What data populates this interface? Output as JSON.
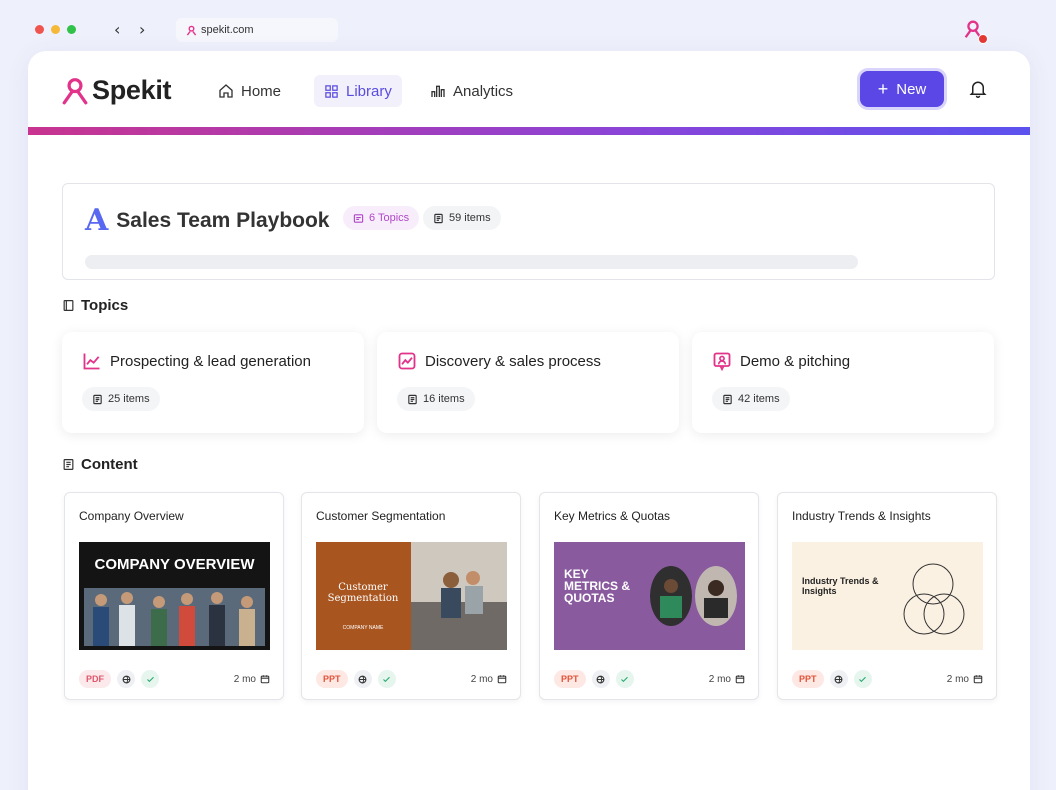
{
  "browser": {
    "url": "spekit.com",
    "back": "‹",
    "forward": "›"
  },
  "brand": {
    "name": "Spekit",
    "accent": "#5a47e6",
    "pink": "#e2338a"
  },
  "nav": {
    "home": "Home",
    "library": "Library",
    "analytics": "Analytics",
    "new_label": "New"
  },
  "playbook": {
    "title": "Sales Team Playbook",
    "topics_badge": "6 Topics",
    "items_badge": "59 items"
  },
  "topics_section": {
    "heading": "Topics",
    "cards": [
      {
        "title": "Prospecting & lead generation",
        "count": "25 items",
        "icon": "chart-line-icon"
      },
      {
        "title": "Discovery & sales process",
        "count": "16 items",
        "icon": "trend-icon"
      },
      {
        "title": "Demo & pitching",
        "count": "42 items",
        "icon": "presenter-icon"
      }
    ]
  },
  "content_section": {
    "heading": "Content",
    "cards": [
      {
        "title": "Company Overview",
        "type": "PDF",
        "age": "2 mo",
        "thumb": {
          "heading": "COMPANY OVERVIEW"
        }
      },
      {
        "title": "Customer Segmentation",
        "type": "PPT",
        "age": "2 mo",
        "thumb": {
          "heading": "Customer Segmentation",
          "sub": "COMPANY NAME"
        }
      },
      {
        "title": "Key Metrics & Quotas",
        "type": "PPT",
        "age": "2 mo",
        "thumb": {
          "heading": "KEY METRICS & QUOTAS"
        }
      },
      {
        "title": "Industry Trends & Insights",
        "type": "PPT",
        "age": "2 mo",
        "thumb": {
          "heading": "Industry Trends & Insights"
        }
      }
    ]
  }
}
